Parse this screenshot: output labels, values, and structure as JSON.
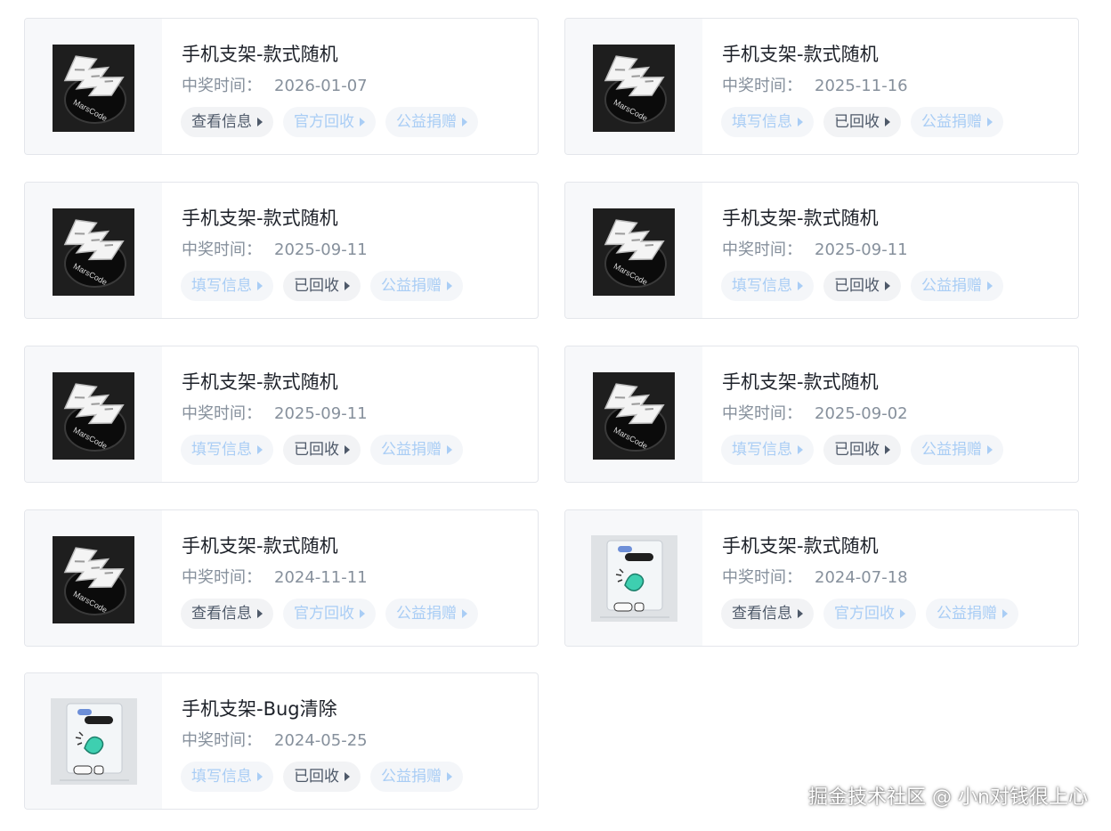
{
  "colors": {
    "active_text": "#4e5969",
    "disabled_text": "#a9cdf5",
    "title": "#1d2129",
    "date": "#86909c"
  },
  "date_label": "中奖时间：",
  "cards": [
    {
      "title": "手机支架-款式随机",
      "date": "2026-01-07",
      "image": "marscode-dark-icon",
      "actions": [
        {
          "label": "查看信息",
          "enabled": true
        },
        {
          "label": "官方回收",
          "enabled": false
        },
        {
          "label": "公益捐赠",
          "enabled": false
        }
      ]
    },
    {
      "title": "手机支架-款式随机",
      "date": "2025-11-16",
      "image": "marscode-dark-icon",
      "actions": [
        {
          "label": "填写信息",
          "enabled": false
        },
        {
          "label": "已回收",
          "enabled": true
        },
        {
          "label": "公益捐赠",
          "enabled": false
        }
      ]
    },
    {
      "title": "手机支架-款式随机",
      "date": "2025-09-11",
      "image": "marscode-dark-icon",
      "actions": [
        {
          "label": "填写信息",
          "enabled": false
        },
        {
          "label": "已回收",
          "enabled": true
        },
        {
          "label": "公益捐赠",
          "enabled": false
        }
      ]
    },
    {
      "title": "手机支架-款式随机",
      "date": "2025-09-11",
      "image": "marscode-dark-icon",
      "actions": [
        {
          "label": "填写信息",
          "enabled": false
        },
        {
          "label": "已回收",
          "enabled": true
        },
        {
          "label": "公益捐赠",
          "enabled": false
        }
      ]
    },
    {
      "title": "手机支架-款式随机",
      "date": "2025-09-11",
      "image": "marscode-dark-icon",
      "actions": [
        {
          "label": "填写信息",
          "enabled": false
        },
        {
          "label": "已回收",
          "enabled": true
        },
        {
          "label": "公益捐赠",
          "enabled": false
        }
      ]
    },
    {
      "title": "手机支架-款式随机",
      "date": "2025-09-02",
      "image": "marscode-dark-icon",
      "actions": [
        {
          "label": "填写信息",
          "enabled": false
        },
        {
          "label": "已回收",
          "enabled": true
        },
        {
          "label": "公益捐赠",
          "enabled": false
        }
      ]
    },
    {
      "title": "手机支架-款式随机",
      "date": "2024-11-11",
      "image": "marscode-dark-icon",
      "actions": [
        {
          "label": "查看信息",
          "enabled": true
        },
        {
          "label": "官方回收",
          "enabled": false
        },
        {
          "label": "公益捐赠",
          "enabled": false
        }
      ]
    },
    {
      "title": "手机支架-款式随机",
      "date": "2024-07-18",
      "image": "clear-stand-icon",
      "actions": [
        {
          "label": "查看信息",
          "enabled": true
        },
        {
          "label": "官方回收",
          "enabled": false
        },
        {
          "label": "公益捐赠",
          "enabled": false
        }
      ]
    },
    {
      "title": "手机支架-Bug清除",
      "date": "2024-05-25",
      "image": "clear-stand-icon",
      "actions": [
        {
          "label": "填写信息",
          "enabled": false
        },
        {
          "label": "已回收",
          "enabled": true
        },
        {
          "label": "公益捐赠",
          "enabled": false
        }
      ]
    }
  ],
  "watermark": "掘金技术社区 @ 小n对钱很上心"
}
